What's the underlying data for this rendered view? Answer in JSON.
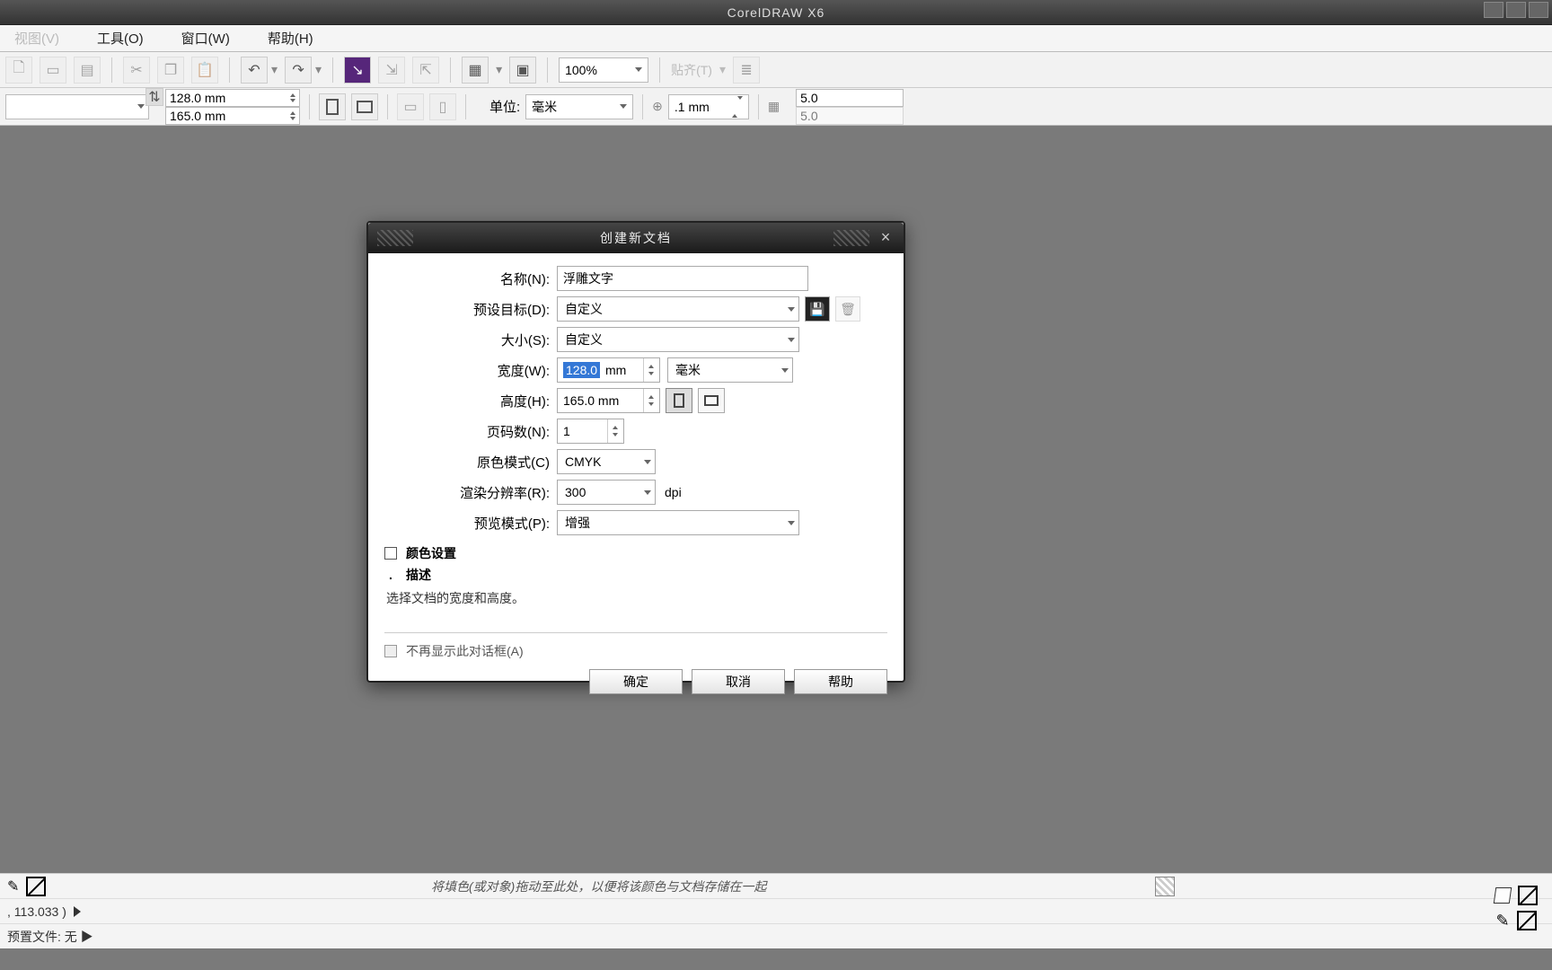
{
  "app_title": "CorelDRAW X6",
  "menubar": {
    "items": [
      "视图(V)",
      "工具(O)",
      "窗口(W)",
      "帮助(H)"
    ]
  },
  "toolbar1": {
    "zoom": "100%"
  },
  "propbar": {
    "width": "128.0 mm",
    "height": "165.0 mm",
    "unit_label": "单位:",
    "unit_value": "毫米",
    "nudge": ".1 mm",
    "ruler_val": "5.0",
    "snap_label": "贴齐(T)"
  },
  "dialog": {
    "title": "创建新文档",
    "labels": {
      "name": "名称(N):",
      "preset": "预设目标(D):",
      "size": "大小(S):",
      "width": "宽度(W):",
      "height": "高度(H):",
      "pages": "页码数(N):",
      "colormode": "原色模式(C)",
      "resolution": "渲染分辨率(R):",
      "preview": "预览模式(P):"
    },
    "values": {
      "name": "浮雕文字",
      "preset": "自定义",
      "size": "自定义",
      "width_val": "128.0",
      "width_unit": "mm",
      "width_unit_combo": "毫米",
      "height": "165.0 mm",
      "pages": "1",
      "colormode": "CMYK",
      "resolution": "300",
      "resolution_unit": "dpi",
      "preview": "增强"
    },
    "expand1": "颜色设置",
    "expand2": "描述",
    "description": "选择文档的宽度和高度。",
    "dont_show": "不再显示此对话框(A)",
    "buttons": {
      "ok": "确定",
      "cancel": "取消",
      "help": "帮助"
    }
  },
  "status": {
    "hint": "将填色(或对象)拖动至此处，以便将该颜色与文档存储在一起",
    "coords": ", 113.033 )",
    "preset_line": "预置文件: 无 ▶"
  }
}
